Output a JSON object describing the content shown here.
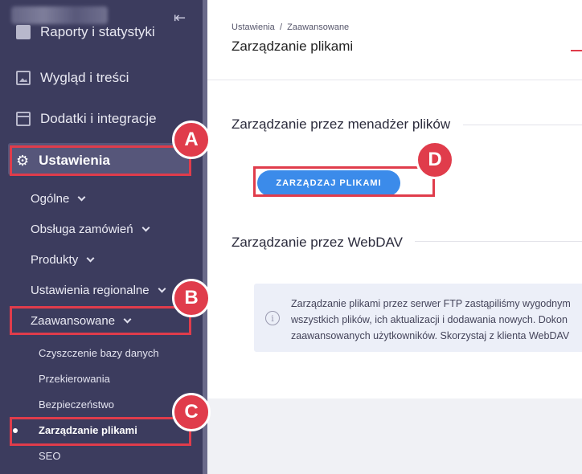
{
  "sidebar": {
    "items": [
      {
        "label": "Raporty i statystyki",
        "icon": "reports-icon"
      },
      {
        "label": "Wygląd i treści",
        "icon": "image-icon"
      },
      {
        "label": "Dodatki i integracje",
        "icon": "calendar-icon"
      }
    ],
    "active": {
      "label": "Ustawienia",
      "icon": "gear-icon"
    },
    "sub": [
      "Ogólne",
      "Obsługa zamówień",
      "Produkty",
      "Ustawienia regionalne",
      "Zaawansowane"
    ],
    "sub2": [
      "Czyszczenie bazy danych",
      "Przekierowania",
      "Bezpieczeństwo",
      "Zarządzanie plikami",
      "SEO"
    ]
  },
  "breadcrumb": {
    "root": "Ustawienia",
    "sep": "/",
    "current": "Zaawansowane"
  },
  "page": {
    "title": "Zarządzanie plikami"
  },
  "sections": {
    "file_manager_title": "Zarządzanie przez menadżer plików",
    "file_manager_button": "ZARZĄDZAJ PLIKAMI",
    "webdav_title": "Zarządzanie przez WebDAV"
  },
  "info": {
    "lines": [
      "Zarządzanie plikami przez serwer FTP zastąpiliśmy wygodnym",
      "wszystkich plików, ich aktualizacji i dodawania nowych. Dokon",
      "zaawansowanych użytkowników. Skorzystaj z klienta WebDAV"
    ]
  },
  "markers": [
    "A",
    "B",
    "C",
    "D"
  ],
  "colors": {
    "sidebar": "#3c3c5e",
    "accent": "#3b8bea",
    "annotation": "#e03c4b"
  }
}
